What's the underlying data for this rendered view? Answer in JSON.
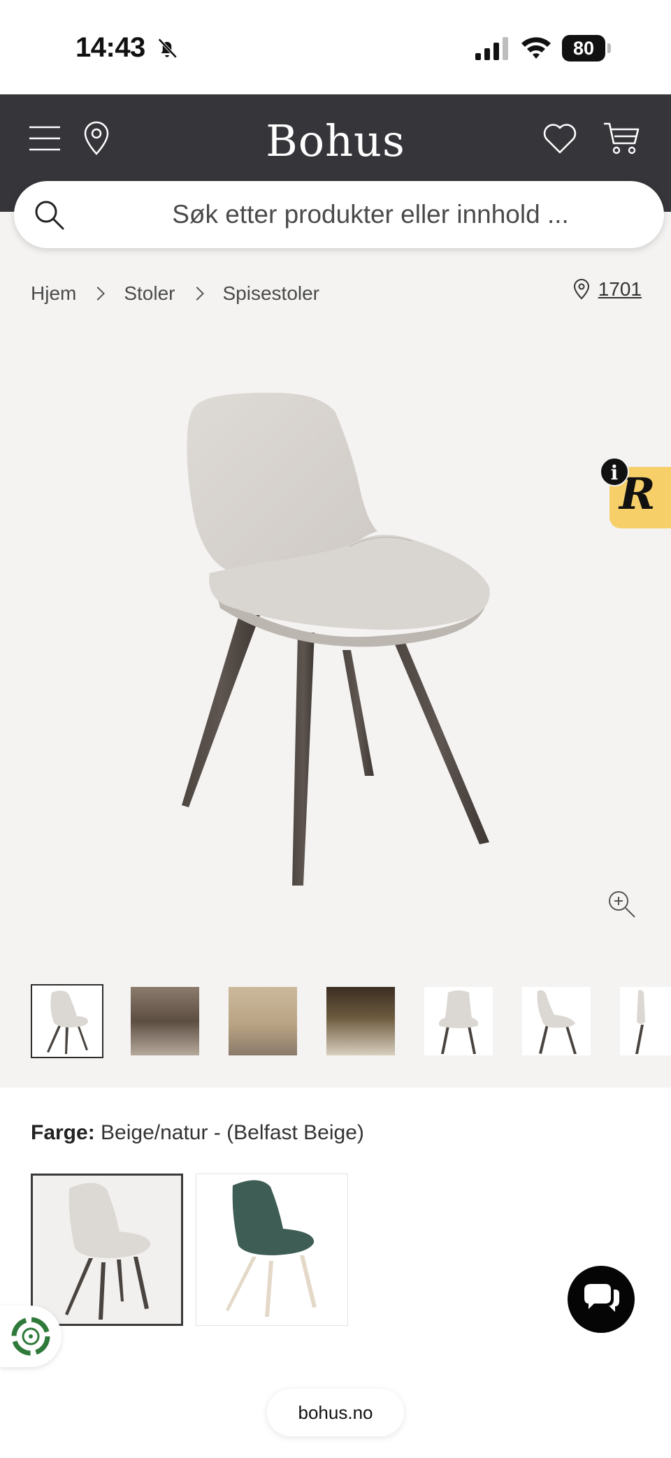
{
  "status_bar": {
    "time": "14:43",
    "battery": "80"
  },
  "header": {
    "logo": "Bohus"
  },
  "search": {
    "placeholder": "Søk etter produkter eller innhold ..."
  },
  "breadcrumb": [
    "Hjem",
    "Stoler",
    "Spisestoler"
  ],
  "store": {
    "code": "1701"
  },
  "widget": {
    "letter": "R",
    "info": "i"
  },
  "thumbnails_count": 7,
  "color": {
    "label": "Farge:",
    "value": "Beige/natur - (Belfast Beige)"
  },
  "swatches": [
    {
      "color": "#dcd8d3",
      "legs": "#4a4440"
    },
    {
      "color": "#3e5d55",
      "legs": "#e4d9c8"
    }
  ],
  "browser": {
    "url": "bohus.no"
  },
  "colors": {
    "header_bg": "#35353a",
    "product_bg": "#f4f3f2",
    "widget_bg": "#f6cf69"
  }
}
